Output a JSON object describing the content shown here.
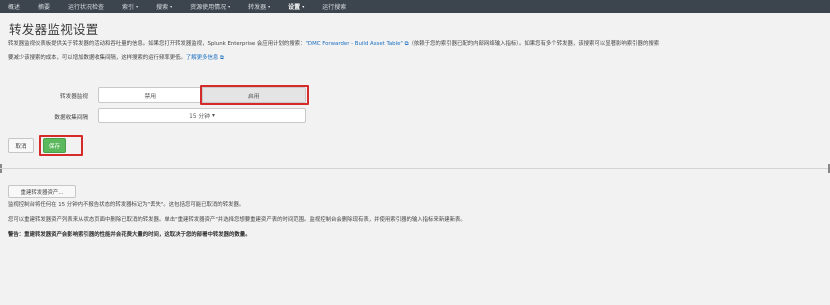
{
  "nav": {
    "items": [
      {
        "label": "概述",
        "caret": ""
      },
      {
        "label": "摘要",
        "caret": ""
      },
      {
        "label": "运行状况检查",
        "caret": ""
      },
      {
        "label": "索引",
        "caret": "▾"
      },
      {
        "label": "搜索",
        "caret": "▾"
      },
      {
        "label": "资源使用情况",
        "caret": "▾"
      },
      {
        "label": "转发器",
        "caret": "▾"
      },
      {
        "label": "设置",
        "caret": "▾"
      },
      {
        "label": "运行搜索",
        "caret": ""
      }
    ]
  },
  "page": {
    "title": "转发器监视设置",
    "desc_line1_a": "转发器监视仪表板提供关于转发器的活动和吞吐量的信息。如果您打开转发器监视，Splunk Enterprise 会应用计划的搜索：",
    "desc_line1_link": "\"DMC Forwarder - Build Asset Table\" ⧉",
    "desc_line1_b": "（依赖于您的索引器已配的内部网络输入指标）。如果您有多个转发器，该搜索可以显著影响索引器的搜索",
    "desc_line2_a": "要减少该搜索的成本，可以增加数据收集间隔，这样搜索的运行频率更低。",
    "desc_line2_link": "了解更多信息 ⧉"
  },
  "form": {
    "monitor_label": "转发器监视",
    "disable_label": "禁用",
    "enable_label": "启用",
    "interval_label": "数据收集间隔",
    "interval_value": "15 分钟",
    "interval_caret": "▾"
  },
  "actions": {
    "cancel_label": "取消",
    "save_label": "保存"
  },
  "rebuild": {
    "button_label": "重建转发器资产...",
    "info1": "监视控制台将任何在 15 分钟内不报告状态的转发器标记为\"丢失\"。这包括您可能已取消的转发器。",
    "info2": "您可以重建转发器资产列表来从状态页面中删除已取消的转发器。单击\"重建转发器资产\"并选择您想要重建资产表的时间范围。监视控制台会删除现有表，并使用索引器的输入指标来新建新表。",
    "warning": "警告：重建转发器资产会影响索引器的性能并会花费大量的时间，这取决于您的部署中转发器的数量。"
  },
  "colors": {
    "nav_bg": "#3c444d",
    "save_green": "#5cb85c",
    "highlight_red": "#d62b2b",
    "link_blue": "#1a6ec0"
  }
}
